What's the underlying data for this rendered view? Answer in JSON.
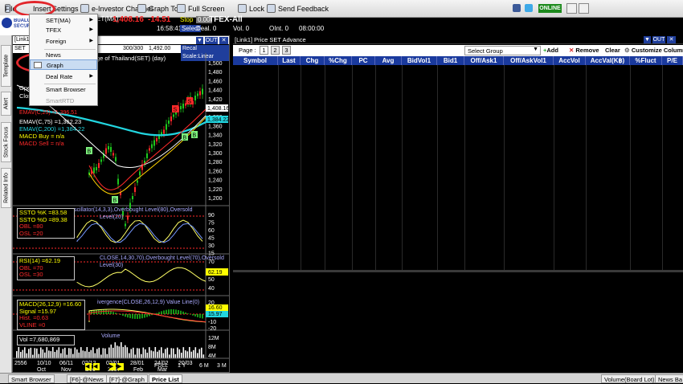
{
  "menubar": {
    "items": [
      "File",
      "Insert",
      "Settings",
      "e-Investor Channel",
      "Graph Tool",
      "Full Screen",
      "Lock",
      "Send Feedback"
    ],
    "online": "ONLINE"
  },
  "ticker": {
    "set_price": "1,408.16",
    "set_change": "-14.51",
    "stop": "Stop",
    "stop_value": "0.00",
    "tfex": "TFEX-All",
    "time": "16:58:41",
    "value_line": "Val. 35,038.85M B.",
    "select": "Select",
    "deal": "Deal. 0",
    "vol": "Vol. 0",
    "oint": "OInt. 0",
    "clock": "08:00:00",
    "index_tag": "ET(MA)"
  },
  "brand": "BUALUANG SECURITIES",
  "sidebar_tabs": [
    "Template",
    "Alert",
    "Stock Focus",
    "Related Info"
  ],
  "chart": {
    "title": "[Link1]",
    "symbol": "SET",
    "description": "ge of Thailand(SET) (day)",
    "btn_out": "OUT",
    "bars_label": "300/300",
    "max_label": "1,492.00",
    "scale_label": "Recal Scale:Linear",
    "price_axis": [
      "1,500",
      "1,480",
      "1,460",
      "1,440",
      "1,420",
      "1,400",
      "1,380",
      "1,360",
      "1,340",
      "1,320",
      "1,300",
      "1,280",
      "1,260",
      "1,240",
      "1,220",
      "1,200"
    ],
    "last_tag": "1,408.16",
    "ema_tag": "1,384.22",
    "legend": {
      "opn": "Ope",
      "cls": "Clos",
      "emav75": "EMAV(C,75)   =1,362.23",
      "emav200": "EMAV(C,200)  =1,384.22",
      "macd_buy": "MACD Buy    = n/a",
      "macd_sell": "MACD Sell    = n/a",
      "ema_partial": "EMAV(C,25)  =1,396.51"
    },
    "signals": [
      "B",
      "B",
      "S",
      "S",
      "B",
      "B"
    ],
    "stoch": {
      "title": "scillator(14,3,3),Overbought Level(80),Oversold",
      "title2": "Level(20)",
      "k": "SSTO %K    =83.58",
      "d": "SSTO %D    =89.38",
      "obl": "OBL    =80",
      "osl": "OSL    =20",
      "axis": [
        "90",
        "75",
        "60",
        "45",
        "30",
        "15"
      ]
    },
    "rsi": {
      "title": "CLOSE,14,30,70),Overbought Level(70),Oversold",
      "title2": "Level(30)",
      "rsi": "RSI(14)    =62.19",
      "obl": "OBL    =70",
      "osl": "OSL    =30",
      "axis": [
        "70",
        "60",
        "50",
        "40"
      ],
      "tag": "62.19"
    },
    "macd": {
      "title": "ivergence(CLOSE,26,12,9) Value Line(0)",
      "macd": "MACD(26,12,9)  =16.60",
      "signal": "Signal  =15.97",
      "hist": "Hist.  =0.63",
      "vline": "VLINE  =0",
      "axis": [
        "20",
        "10",
        "0",
        "-10",
        "-20"
      ],
      "tag": "16.60",
      "tag2": "15.97"
    },
    "volume": {
      "title": "Volume",
      "vol": "Vol   =7,680,869",
      "axis": [
        "12M",
        "8M",
        "4M"
      ]
    },
    "date_axis": [
      "2556",
      "10/10",
      "06/11",
      "02/12",
      "02/01",
      "28/01",
      "24/02",
      "20/03"
    ],
    "date_axis2": [
      "Oct",
      "Nov",
      "Dec",
      "2557",
      "Feb",
      "Mar"
    ],
    "nav": [
      "FULL",
      "1 Y",
      "6 M",
      "3 M"
    ]
  },
  "price_panel": {
    "title": "[Link1] Price SET Advance",
    "btn_out": "OUT",
    "page_label": "Page :",
    "pages": [
      "1",
      "2",
      "3"
    ],
    "group_placeholder": "Select Group",
    "add": "Add",
    "remove": "Remove",
    "clear": "Clear",
    "customize": "Customize Column",
    "columns": [
      "Symbol",
      "Last",
      "Chg",
      "%Chg",
      "PC",
      "Avg",
      "BidVol1",
      "Bid1",
      "Off/Ask1",
      "Off/AskVol1",
      "AccVol",
      "AccVal(K฿)",
      "%Fluct",
      "P/E"
    ]
  },
  "dropdown": {
    "items": [
      "SET(MA)",
      "TFEX",
      "Foreign",
      "News",
      "Graph",
      "Deal Rate",
      "Smart Browser",
      "SmartRTD"
    ]
  },
  "statusbar": {
    "tabs": [
      "Smart Browser",
      "[F6]-@News",
      "[F7]-@Graph",
      "Price List",
      "Volume(Board Lot)",
      "News Ba"
    ]
  },
  "colors": {
    "highlight_red": "#e2262b",
    "header_blue": "#1a3a9e",
    "price_red": "#ff2a2a",
    "price_yellow": "#ffff00",
    "ema_cyan": "#22d6e0",
    "candle_green": "#1ec81e",
    "signal_green": "#7cf07c"
  }
}
